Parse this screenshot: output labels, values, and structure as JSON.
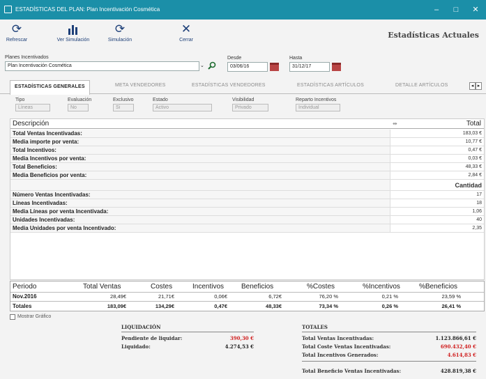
{
  "window": {
    "title": "ESTADÍSTICAS DEL PLAN: Plan Incentivación Cosmética",
    "minimize": "–",
    "maximize": "□",
    "close": "✕"
  },
  "toolbar": {
    "refresh": "Refrescar",
    "simulation": "Ver Simulación",
    "simulate": "Simulación",
    "close": "Cerrar",
    "heading": "Estadísticas Actuales"
  },
  "filters": {
    "plan_label": "Planes Incentivados",
    "plan_value": "Plan Incentivación Cosmética",
    "from_label": "Desde",
    "from_value": "03/06/16",
    "to_label": "Hasta",
    "to_value": "31/12/17"
  },
  "tabs": [
    {
      "label": "ESTADÍSTICAS GENERALES"
    },
    {
      "label": "META VENDEDORES"
    },
    {
      "label": "ESTADÍSTICAS VENDEDORES"
    },
    {
      "label": "ESTADÍSTICAS ARTÍCULOS"
    },
    {
      "label": "DETALLE ARTÍCULOS"
    }
  ],
  "props": [
    {
      "label": "Tipo",
      "value": "Líneas"
    },
    {
      "label": "Evaluación",
      "value": "No"
    },
    {
      "label": "Exclusivo",
      "value": "Si"
    },
    {
      "label": "Estado",
      "value": "Activo"
    },
    {
      "label": "Visibilidad",
      "value": "Privado"
    },
    {
      "label": "Reparto Incentivos",
      "value": "Individual"
    }
  ],
  "stats": {
    "col_desc": "Descripción",
    "col_total": "Total",
    "rows": [
      {
        "label": "Total Ventas Incentivadas:",
        "value": "183,03 €"
      },
      {
        "label": "Media importe por venta:",
        "value": "10,77 €"
      },
      {
        "label": "Total Incentivos:",
        "value": "0,47 €"
      },
      {
        "label": "Media Incentivos por venta:",
        "value": "0,03 €"
      },
      {
        "label": "Total Beneficios:",
        "value": "48,33 €"
      },
      {
        "label": "Media Beneficios por venta:",
        "value": "2,84 €"
      }
    ],
    "quantity_header": "Cantidad",
    "rows2": [
      {
        "label": "Número Ventas Incentivadas:",
        "value": "17"
      },
      {
        "label": "Líneas Incentivadas:",
        "value": "18"
      },
      {
        "label": "Media Líneas por venta Incentivada:",
        "value": "1,06"
      },
      {
        "label": "Unidades Incentivadas:",
        "value": "40"
      },
      {
        "label": "Media Unidades por venta Incentivado:",
        "value": "2,35"
      }
    ]
  },
  "period_table": {
    "headers": [
      "Periodo",
      "Total Ventas",
      "Costes",
      "Incentivos",
      "Beneficios",
      "%Costes",
      "%Incentivos",
      "%Beneficios"
    ],
    "row": [
      "Nov.2016",
      "28,49€",
      "21,71€",
      "0,06€",
      "6,72€",
      "76,20 %",
      "0,21 %",
      "23,59 %"
    ],
    "totals": [
      "Totales",
      "183,09€",
      "134,29€",
      "0,47€",
      "48,33€",
      "73,34 %",
      "0,26 %",
      "26,41 %"
    ]
  },
  "show_chart": "Mostrar Gráfico",
  "liquidacion": {
    "title": "LIQUIDACIÓN",
    "pending_label": "Pendiente de liquidar:",
    "pending_value": "390,30 €",
    "settled_label": "Liquidado:",
    "settled_value": "4.274,53 €"
  },
  "totales": {
    "title": "TOTALES",
    "rows": [
      {
        "label": "Total Ventas Incentivadas:",
        "value": "1.123.866,61 €"
      },
      {
        "label": "Total Coste Ventas Incentivadas:",
        "value": "690.432,40 €"
      },
      {
        "label": "Total Incentivos Generados:",
        "value": "4.614,83 €"
      }
    ],
    "profit_label": "Total Beneficio Ventas Incentivadas:",
    "profit_value": "428.819,38 €"
  },
  "colors": {
    "titlebar": "#1b8fa8",
    "accent_red": "#d02020",
    "toolbar_icon": "#1d3f78"
  }
}
